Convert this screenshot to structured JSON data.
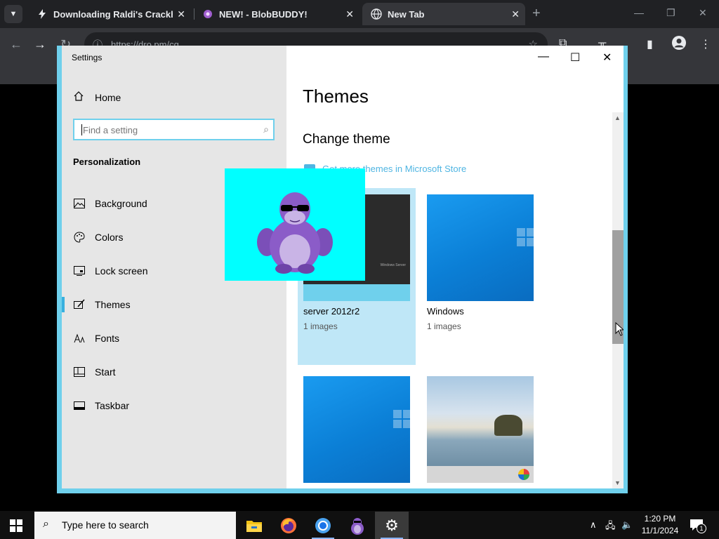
{
  "browser": {
    "tabs": [
      {
        "title": "Downloading Raldi's Crackhou",
        "active": false
      },
      {
        "title": "NEW! - BlobBUDDY!",
        "active": false
      },
      {
        "title": "New Tab",
        "active": true
      }
    ],
    "url": "https://dro.pm/cq"
  },
  "settings": {
    "window_title": "Settings",
    "home_label": "Home",
    "search_placeholder": "Find a setting",
    "section_label": "Personalization",
    "nav_items": [
      {
        "label": "Background",
        "icon": "image-icon"
      },
      {
        "label": "Colors",
        "icon": "palette-icon"
      },
      {
        "label": "Lock screen",
        "icon": "lock-screen-icon"
      },
      {
        "label": "Themes",
        "icon": "brush-icon",
        "active": true
      },
      {
        "label": "Fonts",
        "icon": "font-icon"
      },
      {
        "label": "Start",
        "icon": "start-icon"
      },
      {
        "label": "Taskbar",
        "icon": "taskbar-icon"
      }
    ],
    "page_title": "Themes",
    "subheading": "Change theme",
    "store_link": "Get more themes in Microsoft Store",
    "themes": [
      {
        "name": "server 2012r2",
        "count": "1 images",
        "selected": true,
        "mini_text": "Windows Server"
      },
      {
        "name": "Windows",
        "count": "1 images",
        "selected": false
      }
    ]
  },
  "taskbar": {
    "search_placeholder": "Type here to search",
    "time": "1:20 PM",
    "date": "11/1/2024",
    "notification_count": "1"
  },
  "colors": {
    "accent": "#38b0de",
    "window_border": "#6fd0ec",
    "overlay_bg": "#00ffff"
  }
}
